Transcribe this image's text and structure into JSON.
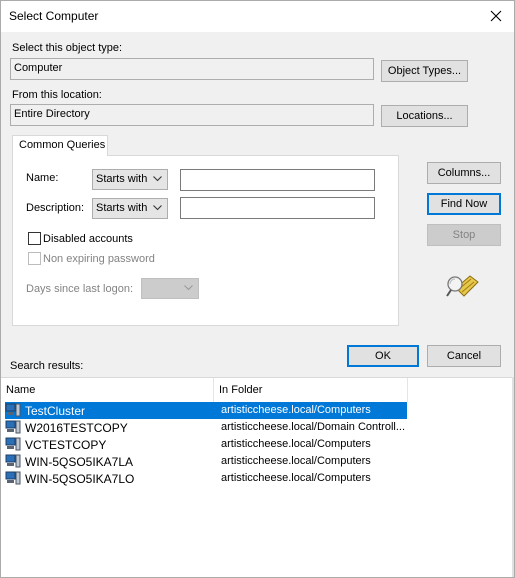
{
  "window": {
    "title": "Select Computer"
  },
  "object_type": {
    "label": "Select this object type:",
    "value": "Computer",
    "button": "Object Types..."
  },
  "location": {
    "label": "From this location:",
    "value": "Entire Directory",
    "button": "Locations..."
  },
  "queries": {
    "tab_label": "Common Queries",
    "name_label": "Name:",
    "name_mode": "Starts with",
    "name_value": "",
    "description_label": "Description:",
    "description_mode": "Starts with",
    "description_value": "",
    "disabled_accounts_label": "Disabled accounts",
    "disabled_accounts_checked": false,
    "non_expiring_label": "Non expiring password",
    "days_label": "Days since last logon:",
    "days_value": ""
  },
  "side_buttons": {
    "columns": "Columns...",
    "find_now": "Find Now",
    "stop": "Stop",
    "search_icon": "flashlight-search-icon"
  },
  "dialog_buttons": {
    "ok": "OK",
    "cancel": "Cancel"
  },
  "results": {
    "label": "Search results:",
    "columns": [
      "Name",
      "In Folder"
    ],
    "rows": [
      {
        "name": "TestCluster",
        "folder": "artisticcheese.local/Computers",
        "selected": true
      },
      {
        "name": "W2016TESTCOPY",
        "folder": "artisticcheese.local/Domain Controll...",
        "selected": false
      },
      {
        "name": "VCTESTCOPY",
        "folder": "artisticcheese.local/Computers",
        "selected": false
      },
      {
        "name": "WIN-5QSO5IKA7LA",
        "folder": "artisticcheese.local/Computers",
        "selected": false
      },
      {
        "name": "WIN-5QSO5IKA7LO",
        "folder": "artisticcheese.local/Computers",
        "selected": false
      }
    ],
    "row_icon": "computer-icon"
  },
  "colors": {
    "accent": "#0078d7",
    "dialog_bg": "#f0f0f0"
  }
}
